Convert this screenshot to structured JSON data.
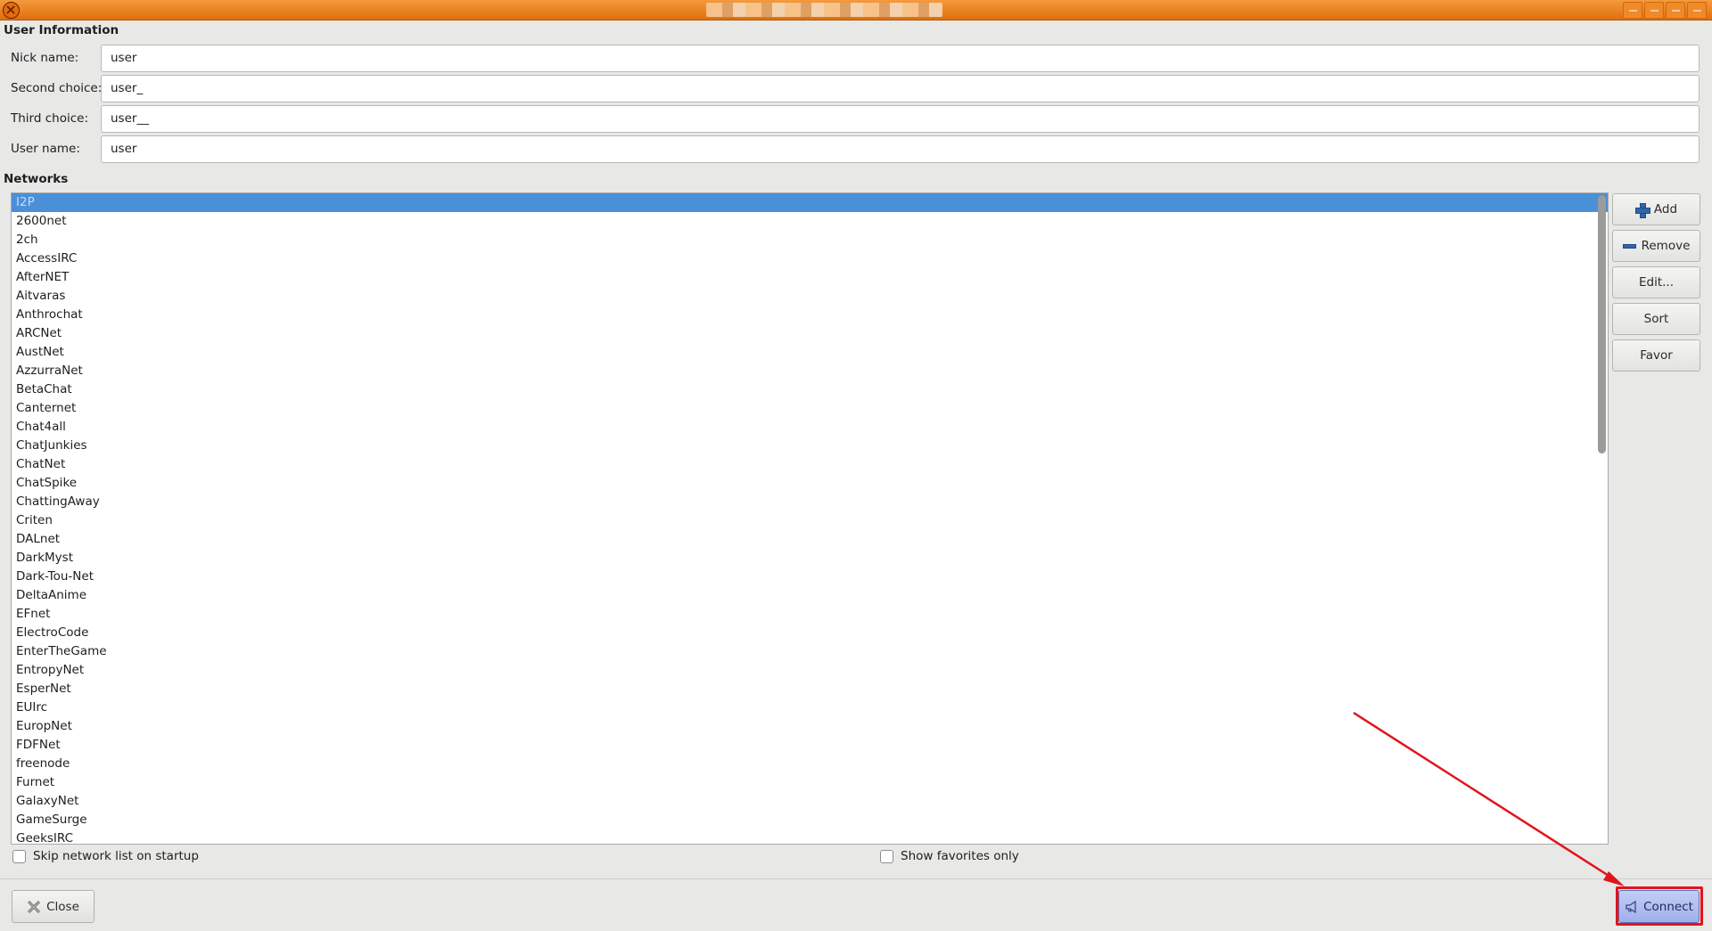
{
  "window": {
    "close_icon": "close-icon"
  },
  "user_info": {
    "heading": "User Information",
    "fields": [
      {
        "label": "Nick name:",
        "value": "user"
      },
      {
        "label": "Second choice:",
        "value": "user_"
      },
      {
        "label": "Third choice:",
        "value": "user__"
      },
      {
        "label": "User name:",
        "value": "user"
      }
    ]
  },
  "networks": {
    "heading": "Networks",
    "selected": "I2P",
    "items": [
      "I2P",
      "2600net",
      "2ch",
      "AccessIRC",
      "AfterNET",
      "Aitvaras",
      "Anthrochat",
      "ARCNet",
      "AustNet",
      "AzzurraNet",
      "BetaChat",
      "Canternet",
      "Chat4all",
      "ChatJunkies",
      "ChatNet",
      "ChatSpike",
      "ChattingAway",
      "Criten",
      "DALnet",
      "DarkMyst",
      "Dark-Tou-Net",
      "DeltaAnime",
      "EFnet",
      "ElectroCode",
      "EnterTheGame",
      "EntropyNet",
      "EsperNet",
      "EUIrc",
      "EuropNet",
      "FDFNet",
      "freenode",
      "Furnet",
      "GalaxyNet",
      "GameSurge",
      "GeeksIRC"
    ]
  },
  "side_buttons": {
    "add": "Add",
    "remove": "Remove",
    "edit": "Edit...",
    "sort": "Sort",
    "favor": "Favor"
  },
  "options": {
    "skip_startup": "Skip network list on startup",
    "favorites_only": "Show favorites only"
  },
  "bottom": {
    "close": "Close",
    "connect": "Connect"
  },
  "colors": {
    "titlebar": "#e8801c",
    "selection": "#4a90d9",
    "highlight": "#e2141b"
  }
}
